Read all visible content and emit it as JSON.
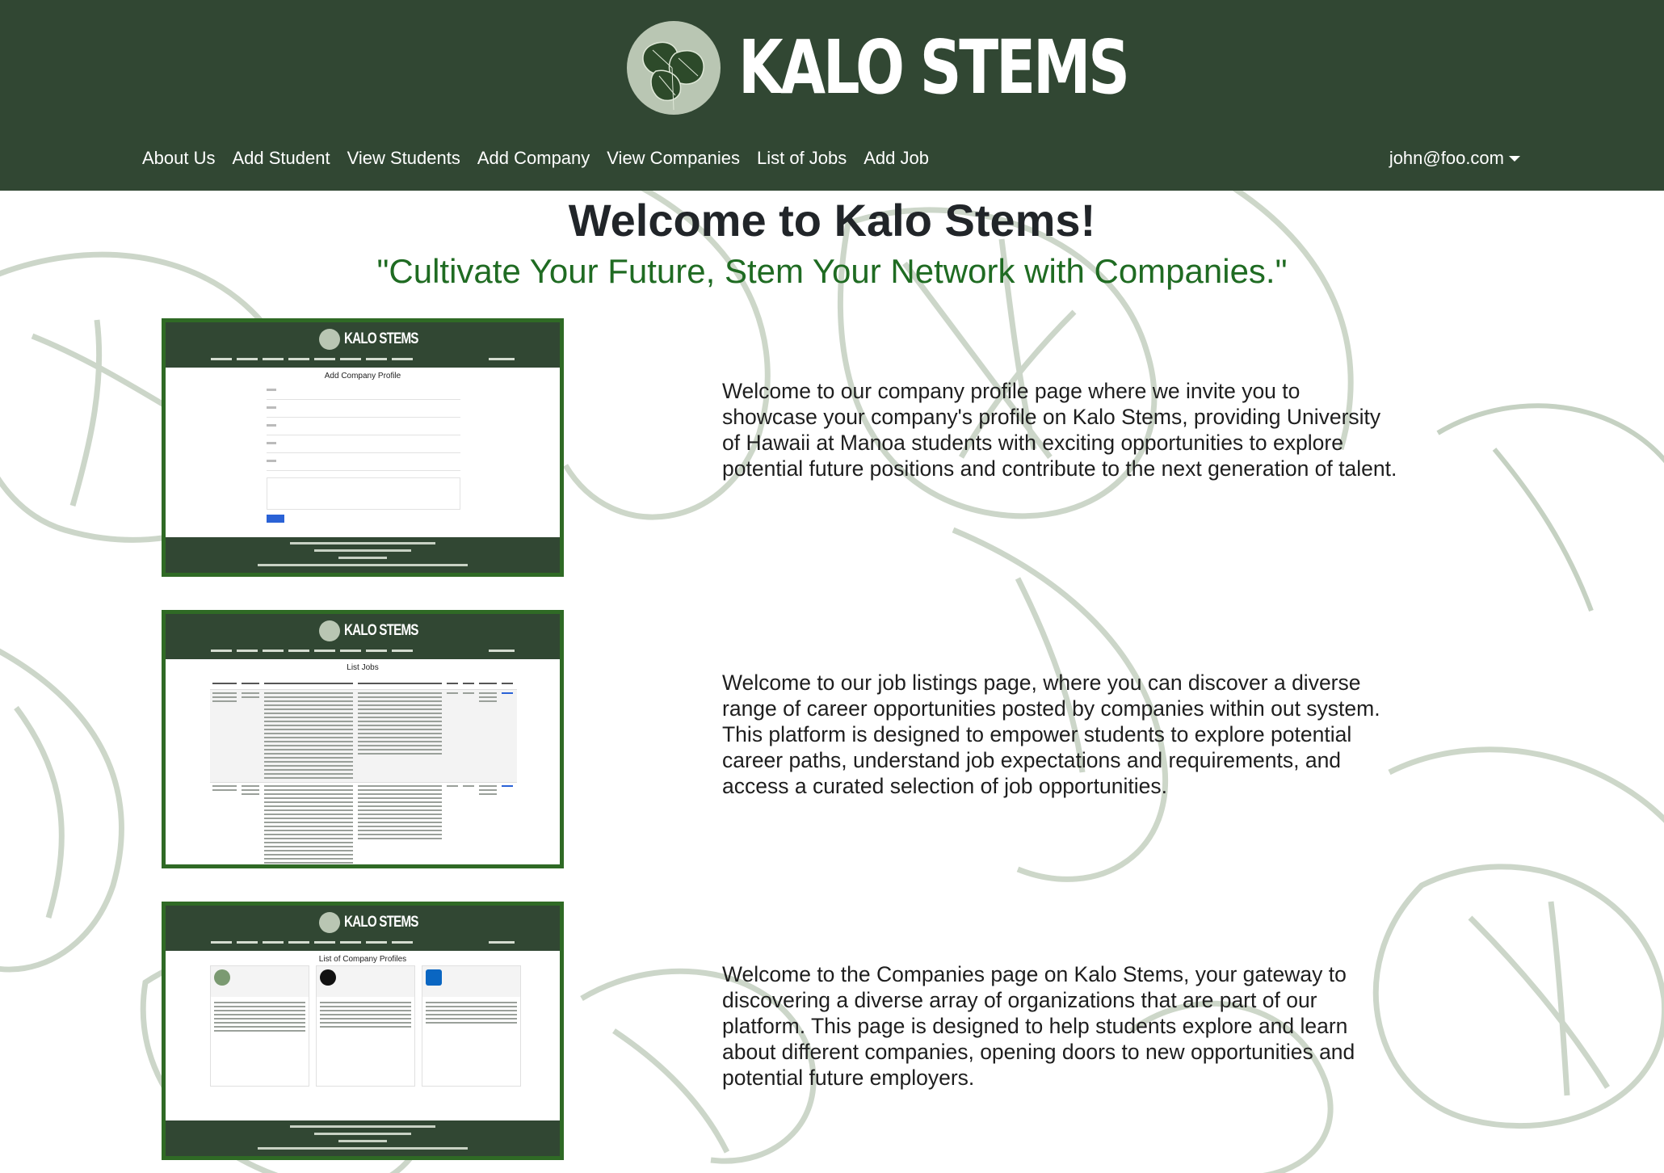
{
  "brand": {
    "name": "KALO STEMS"
  },
  "nav": {
    "items": [
      "About Us",
      "Add Student",
      "View Students",
      "Add Company",
      "View Companies",
      "List of Jobs",
      "Add Job"
    ],
    "user": "john@foo.com"
  },
  "hero": {
    "title": "Welcome to Kalo Stems!",
    "tagline": "\"Cultivate Your Future, Stem Your Network with Companies.\""
  },
  "features": [
    {
      "mini_title": "Add Company Profile",
      "text": "Welcome to our company profile page where we invite you to showcase your company's profile on Kalo Stems, providing University of Hawaii at Manoa students with exciting opportunities to explore potential future positions and contribute to the next generation of talent."
    },
    {
      "mini_title": "List Jobs",
      "text": "Welcome to our job listings page, where you can discover a diverse range of career opportunities posted by companies within out system. This platform is designed to empower students to explore potential career paths, understand job expectations and requirements, and access a curated selection of job opportunities."
    },
    {
      "mini_title": "List of Company Profiles",
      "text": "Welcome to the Companies page on Kalo Stems, your gateway to discovering a diverse array of organizations that are part of our platform. This page is designed to help students explore and learn about different companies, opening doors to new opportunities and potential future employers."
    }
  ],
  "colors": {
    "header": "#314733",
    "accent": "#1f6b22",
    "frame": "#2f6a25"
  },
  "icons": [
    "taro-leaf-logo-icon",
    "caret-down-icon"
  ]
}
